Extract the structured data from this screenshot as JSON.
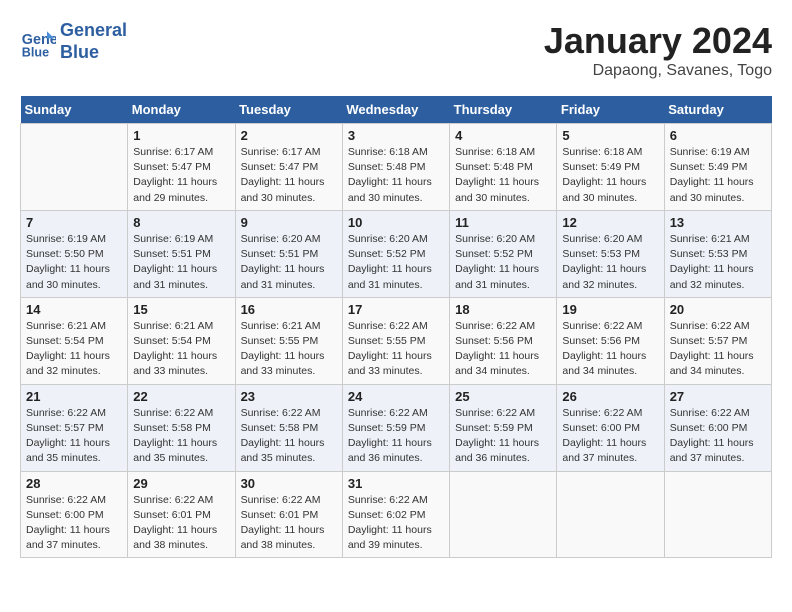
{
  "header": {
    "logo_line1": "General",
    "logo_line2": "Blue",
    "month": "January 2024",
    "location": "Dapaong, Savanes, Togo"
  },
  "weekdays": [
    "Sunday",
    "Monday",
    "Tuesday",
    "Wednesday",
    "Thursday",
    "Friday",
    "Saturday"
  ],
  "weeks": [
    [
      {
        "day": "",
        "info": ""
      },
      {
        "day": "1",
        "info": "Sunrise: 6:17 AM\nSunset: 5:47 PM\nDaylight: 11 hours\nand 29 minutes."
      },
      {
        "day": "2",
        "info": "Sunrise: 6:17 AM\nSunset: 5:47 PM\nDaylight: 11 hours\nand 30 minutes."
      },
      {
        "day": "3",
        "info": "Sunrise: 6:18 AM\nSunset: 5:48 PM\nDaylight: 11 hours\nand 30 minutes."
      },
      {
        "day": "4",
        "info": "Sunrise: 6:18 AM\nSunset: 5:48 PM\nDaylight: 11 hours\nand 30 minutes."
      },
      {
        "day": "5",
        "info": "Sunrise: 6:18 AM\nSunset: 5:49 PM\nDaylight: 11 hours\nand 30 minutes."
      },
      {
        "day": "6",
        "info": "Sunrise: 6:19 AM\nSunset: 5:49 PM\nDaylight: 11 hours\nand 30 minutes."
      }
    ],
    [
      {
        "day": "7",
        "info": "Sunrise: 6:19 AM\nSunset: 5:50 PM\nDaylight: 11 hours\nand 30 minutes."
      },
      {
        "day": "8",
        "info": "Sunrise: 6:19 AM\nSunset: 5:51 PM\nDaylight: 11 hours\nand 31 minutes."
      },
      {
        "day": "9",
        "info": "Sunrise: 6:20 AM\nSunset: 5:51 PM\nDaylight: 11 hours\nand 31 minutes."
      },
      {
        "day": "10",
        "info": "Sunrise: 6:20 AM\nSunset: 5:52 PM\nDaylight: 11 hours\nand 31 minutes."
      },
      {
        "day": "11",
        "info": "Sunrise: 6:20 AM\nSunset: 5:52 PM\nDaylight: 11 hours\nand 31 minutes."
      },
      {
        "day": "12",
        "info": "Sunrise: 6:20 AM\nSunset: 5:53 PM\nDaylight: 11 hours\nand 32 minutes."
      },
      {
        "day": "13",
        "info": "Sunrise: 6:21 AM\nSunset: 5:53 PM\nDaylight: 11 hours\nand 32 minutes."
      }
    ],
    [
      {
        "day": "14",
        "info": "Sunrise: 6:21 AM\nSunset: 5:54 PM\nDaylight: 11 hours\nand 32 minutes."
      },
      {
        "day": "15",
        "info": "Sunrise: 6:21 AM\nSunset: 5:54 PM\nDaylight: 11 hours\nand 33 minutes."
      },
      {
        "day": "16",
        "info": "Sunrise: 6:21 AM\nSunset: 5:55 PM\nDaylight: 11 hours\nand 33 minutes."
      },
      {
        "day": "17",
        "info": "Sunrise: 6:22 AM\nSunset: 5:55 PM\nDaylight: 11 hours\nand 33 minutes."
      },
      {
        "day": "18",
        "info": "Sunrise: 6:22 AM\nSunset: 5:56 PM\nDaylight: 11 hours\nand 34 minutes."
      },
      {
        "day": "19",
        "info": "Sunrise: 6:22 AM\nSunset: 5:56 PM\nDaylight: 11 hours\nand 34 minutes."
      },
      {
        "day": "20",
        "info": "Sunrise: 6:22 AM\nSunset: 5:57 PM\nDaylight: 11 hours\nand 34 minutes."
      }
    ],
    [
      {
        "day": "21",
        "info": "Sunrise: 6:22 AM\nSunset: 5:57 PM\nDaylight: 11 hours\nand 35 minutes."
      },
      {
        "day": "22",
        "info": "Sunrise: 6:22 AM\nSunset: 5:58 PM\nDaylight: 11 hours\nand 35 minutes."
      },
      {
        "day": "23",
        "info": "Sunrise: 6:22 AM\nSunset: 5:58 PM\nDaylight: 11 hours\nand 35 minutes."
      },
      {
        "day": "24",
        "info": "Sunrise: 6:22 AM\nSunset: 5:59 PM\nDaylight: 11 hours\nand 36 minutes."
      },
      {
        "day": "25",
        "info": "Sunrise: 6:22 AM\nSunset: 5:59 PM\nDaylight: 11 hours\nand 36 minutes."
      },
      {
        "day": "26",
        "info": "Sunrise: 6:22 AM\nSunset: 6:00 PM\nDaylight: 11 hours\nand 37 minutes."
      },
      {
        "day": "27",
        "info": "Sunrise: 6:22 AM\nSunset: 6:00 PM\nDaylight: 11 hours\nand 37 minutes."
      }
    ],
    [
      {
        "day": "28",
        "info": "Sunrise: 6:22 AM\nSunset: 6:00 PM\nDaylight: 11 hours\nand 37 minutes."
      },
      {
        "day": "29",
        "info": "Sunrise: 6:22 AM\nSunset: 6:01 PM\nDaylight: 11 hours\nand 38 minutes."
      },
      {
        "day": "30",
        "info": "Sunrise: 6:22 AM\nSunset: 6:01 PM\nDaylight: 11 hours\nand 38 minutes."
      },
      {
        "day": "31",
        "info": "Sunrise: 6:22 AM\nSunset: 6:02 PM\nDaylight: 11 hours\nand 39 minutes."
      },
      {
        "day": "",
        "info": ""
      },
      {
        "day": "",
        "info": ""
      },
      {
        "day": "",
        "info": ""
      }
    ]
  ]
}
